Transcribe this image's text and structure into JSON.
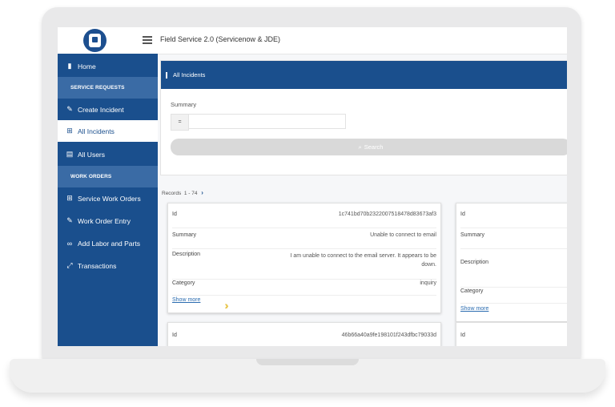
{
  "app": {
    "title": "Field Service 2.0 (Servicenow & JDE)"
  },
  "sidebar": {
    "items": [
      {
        "label": "Home",
        "icon": "bar-chart-icon"
      },
      {
        "label": "SERVICE REQUESTS",
        "type": "section"
      },
      {
        "label": "Create Incident",
        "icon": "pencil-icon"
      },
      {
        "label": "All Incidents",
        "icon": "grid-icon",
        "active": true
      },
      {
        "label": "All Users",
        "icon": "id-card-icon"
      },
      {
        "label": "WORK ORDERS",
        "type": "section"
      },
      {
        "label": "Service Work Orders",
        "icon": "grid-icon"
      },
      {
        "label": "Work Order Entry",
        "icon": "pencil-icon"
      },
      {
        "label": "Add Labor and Parts",
        "icon": "link-icon"
      },
      {
        "label": "Transactions",
        "icon": "expand-icon"
      }
    ]
  },
  "panel": {
    "title": "All Incidents",
    "summary_label": "Summary",
    "operator": "=",
    "summary_value": "",
    "search_label": "Search"
  },
  "records": {
    "label": "Records",
    "range": "1 - 74"
  },
  "cards": [
    {
      "id_label": "Id",
      "id": "1c741bd70b2322007518478d83673af3",
      "summary_label": "Summary",
      "summary": "Unable to connect to email",
      "description_label": "Description",
      "description": "I am unable to connect to the email server. It appears to be down.",
      "category_label": "Category",
      "category": "inquiry",
      "show_more": "Show more"
    },
    {
      "id_label": "Id",
      "id": "",
      "summary_label": "Summary",
      "summary": "",
      "description_label": "Description",
      "description": "",
      "category_label": "Category",
      "category": "",
      "show_more": "Show more"
    },
    {
      "id_label": "Id",
      "id": "46b66a40a9fe198101f243dfbc79033d"
    },
    {
      "id_label": "Id",
      "id": ""
    }
  ],
  "colors": {
    "brand": "#1a4f8d",
    "section": "#3a6ba5",
    "accent_arrows": "#e8c74e",
    "link": "#2b6cb0"
  }
}
